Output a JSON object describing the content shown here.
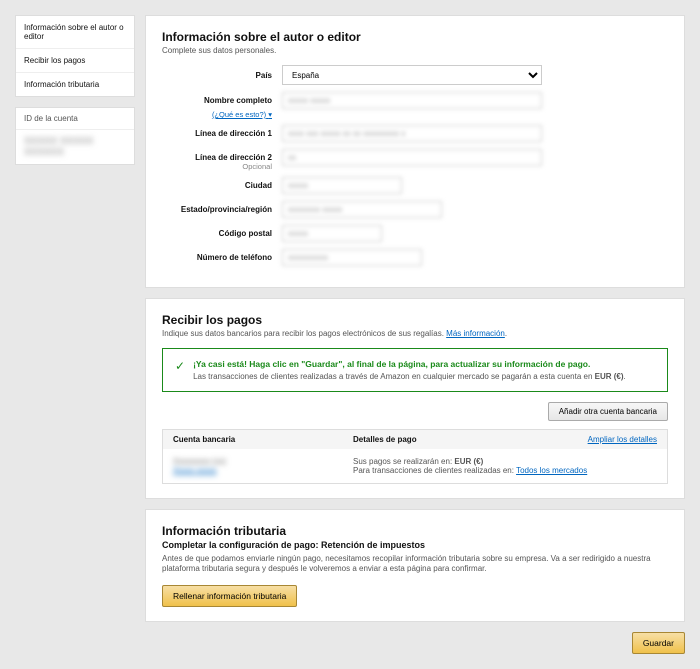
{
  "sidebar": {
    "items": [
      "Información sobre el autor o editor",
      "Recibir los pagos",
      "Información tributaria"
    ],
    "account_id_label": "ID de la cuenta",
    "account_id_value": "XXXXX XXXXX XXXXXX"
  },
  "author": {
    "title": "Información sobre el autor o editor",
    "subtitle": "Complete sus datos personales.",
    "fields": {
      "country_label": "País",
      "country_value": "España",
      "name_label": "Nombre completo",
      "name_help": "(¿Qué es esto?)",
      "name_value": "xxxxx xxxxx",
      "addr1_label": "Línea de dirección 1",
      "addr1_value": "xxxx xxx xxxxx xx xx xxxxxxxxx x",
      "addr2_label": "Línea de dirección 2",
      "addr2_opt": "Opcional",
      "addr2_value": "xx",
      "city_label": "Ciudad",
      "city_value": "xxxxx",
      "region_label": "Estado/provincia/región",
      "region_value": "xxxxxxxx xxxxx",
      "postal_label": "Código postal",
      "postal_value": "xxxxx",
      "phone_label": "Número de teléfono",
      "phone_value": "xxxxxxxxxx"
    }
  },
  "payments": {
    "title": "Recibir los pagos",
    "desc": "Indique sus datos bancarios para recibir los pagos electrónicos de sus regalías. ",
    "desc_link": "Más información",
    "alert_title": "¡Ya casi está! Haga clic en \"Guardar\", al final de la página, para actualizar su información de pago.",
    "alert_text": "Las transacciones de clientes realizadas a través de Amazon en cualquier mercado se pagarán a esta cuenta en ",
    "alert_currency": "EUR (€)",
    "add_button": "Añadir otra cuenta bancaria",
    "col_account": "Cuenta bancaria",
    "col_details": "Detalles de pago",
    "expand_link": "Ampliar los detalles",
    "bank_name": "Xxxxxxxxx (xx)",
    "bank_edit": "Xxxxx xxxxx",
    "detail_line1_a": "Sus pagos se realizarán en: ",
    "detail_line1_b": "EUR (€)",
    "detail_line2_a": "Para transacciones de clientes realizadas en: ",
    "detail_line2_b": "Todos los mercados"
  },
  "tax": {
    "title": "Información tributaria",
    "subtitle": "Completar la configuración de pago: Retención de impuestos",
    "text": "Antes de que podamos enviarle ningún pago, necesitamos recopilar información tributaria sobre su empresa. Va a ser redirigido a nuestra plataforma tributaria segura y después le volveremos a enviar a esta página para confirmar.",
    "button": "Rellenar información tributaria"
  },
  "save_button": "Guardar"
}
